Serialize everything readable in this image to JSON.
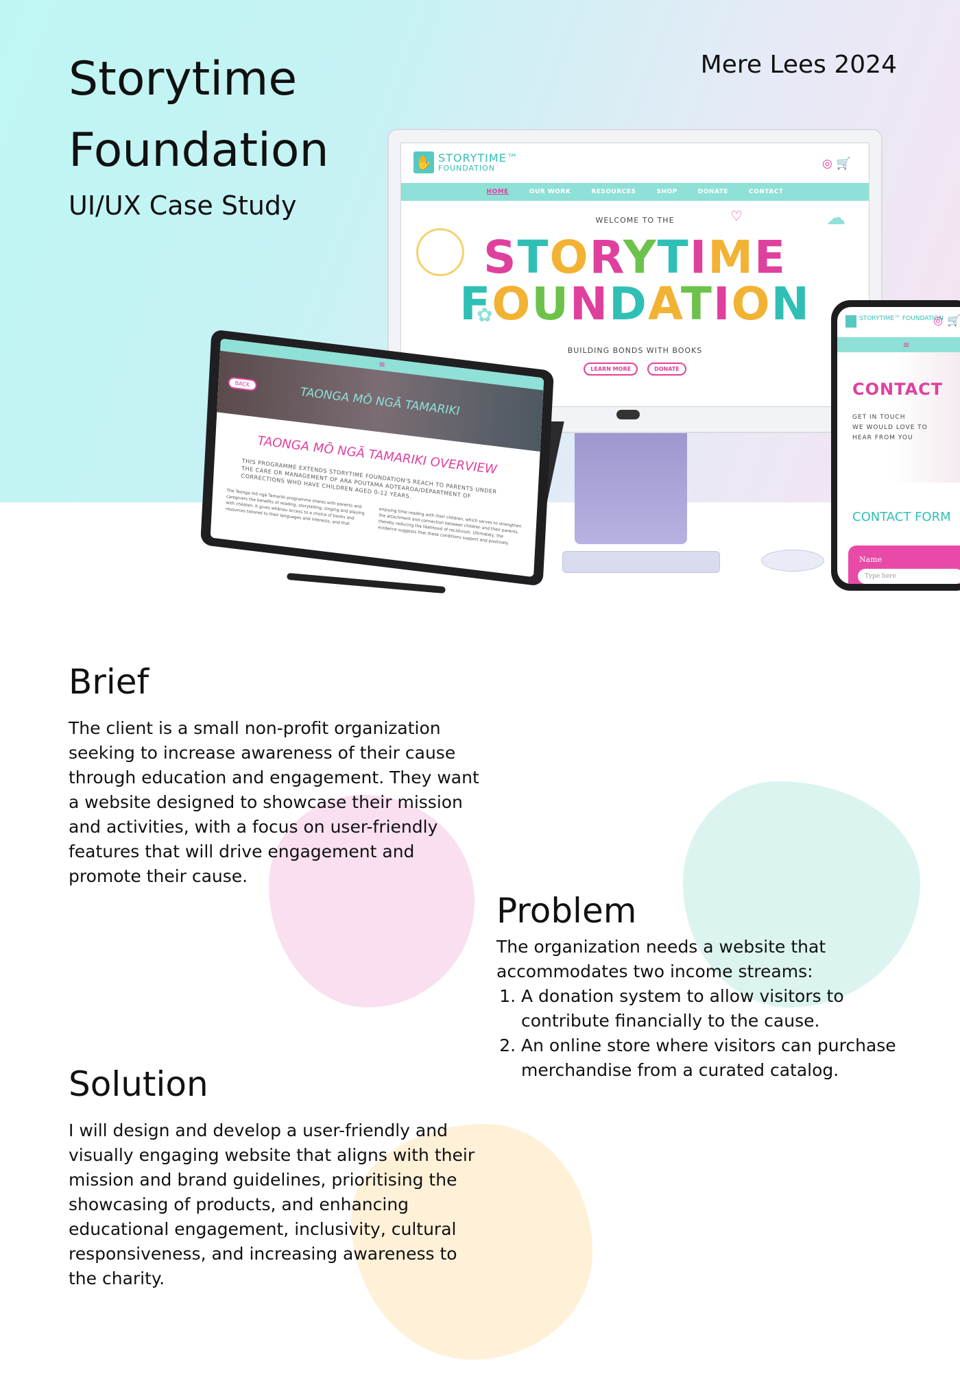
{
  "header": {
    "title": "Storytime Foundation",
    "subtitle": "UI/UX Case Study",
    "author_year": "Mere Lees 2024"
  },
  "mockups": {
    "desktop": {
      "logo_line1": "STORYTIME™",
      "logo_line2": "FOUNDATION",
      "nav": [
        "HOME",
        "OUR WORK",
        "RESOURCES",
        "SHOP",
        "DONATE",
        "CONTACT"
      ],
      "welcome": "WELCOME TO THE",
      "hero_line1": "STORYTIME",
      "hero_line2": "FOUNDATION",
      "tagline": "BUILDING BONDS WITH BOOKS",
      "button_learn": "LEARN MORE",
      "button_donate": "DONATE"
    },
    "tablet": {
      "back": "BACK",
      "banner_title": "TAONGA MŌ NGĀ TAMARIKI",
      "heading": "TAONGA MŌ NGĀ TAMARIKI OVERVIEW",
      "intro": "THIS PROGRAMME EXTENDS STORYTIME FOUNDATION'S REACH TO PARENTS UNDER THE CARE OR MANAGEMENT OF ARA POUTAMA AOTEAROA/DEPARTMENT OF CORRECTIONS WHO HAVE CHILDREN AGED 0-12 YEARS.",
      "col1": "The Taonga mō ngā Tamariki programme shares with parents and caregivers the benefits of reading, storytelling, singing and playing with children. It gives whānau access to a choice of books and resources tailored to their languages and interests, and that",
      "col2": "enjoying time reading with their children, which serves to strengthen the attachment and connection between children and their parents, thereby reducing the likelihood of recidivism. Ultimately, the evidence suggests that these conditions support and positively"
    },
    "phone": {
      "logo_text": "STORYTIME™ FOUNDATION",
      "contact": "CONTACT",
      "touch_line1": "GET IN TOUCH",
      "touch_line2": "WE WOULD LOVE TO",
      "touch_line3": "HEAR FROM YOU",
      "form_title": "CONTACT FORM",
      "name_label": "Name",
      "name_placeholder": "Type here"
    }
  },
  "brief": {
    "title": "Brief",
    "body": "The client is a small non-profit organization seeking to increase awareness of their cause through education and engagement. They want a website designed to showcase their mission and activities, with a focus on user-friendly features that will drive engagement and promote their cause."
  },
  "problem": {
    "title": "Problem",
    "intro": "The organization needs a website that accommodates two income streams:",
    "items": [
      "A donation system to allow visitors to contribute financially to the cause.",
      "An online store where visitors can purchase merchandise from a curated catalog."
    ]
  },
  "solution": {
    "title": "Solution",
    "body": "I will design and develop a user-friendly and visually engaging website that aligns with their mission and brand guidelines, prioritising the showcasing of products, and enhancing educational engagement, inclusivity, cultural responsiveness, and increasing awareness to the charity."
  },
  "colors": {
    "teal": "#8fe0d6",
    "pink": "#e0409d",
    "hero_gradient_start": "#bff6f4",
    "hero_gradient_end": "#f8e3f1"
  }
}
